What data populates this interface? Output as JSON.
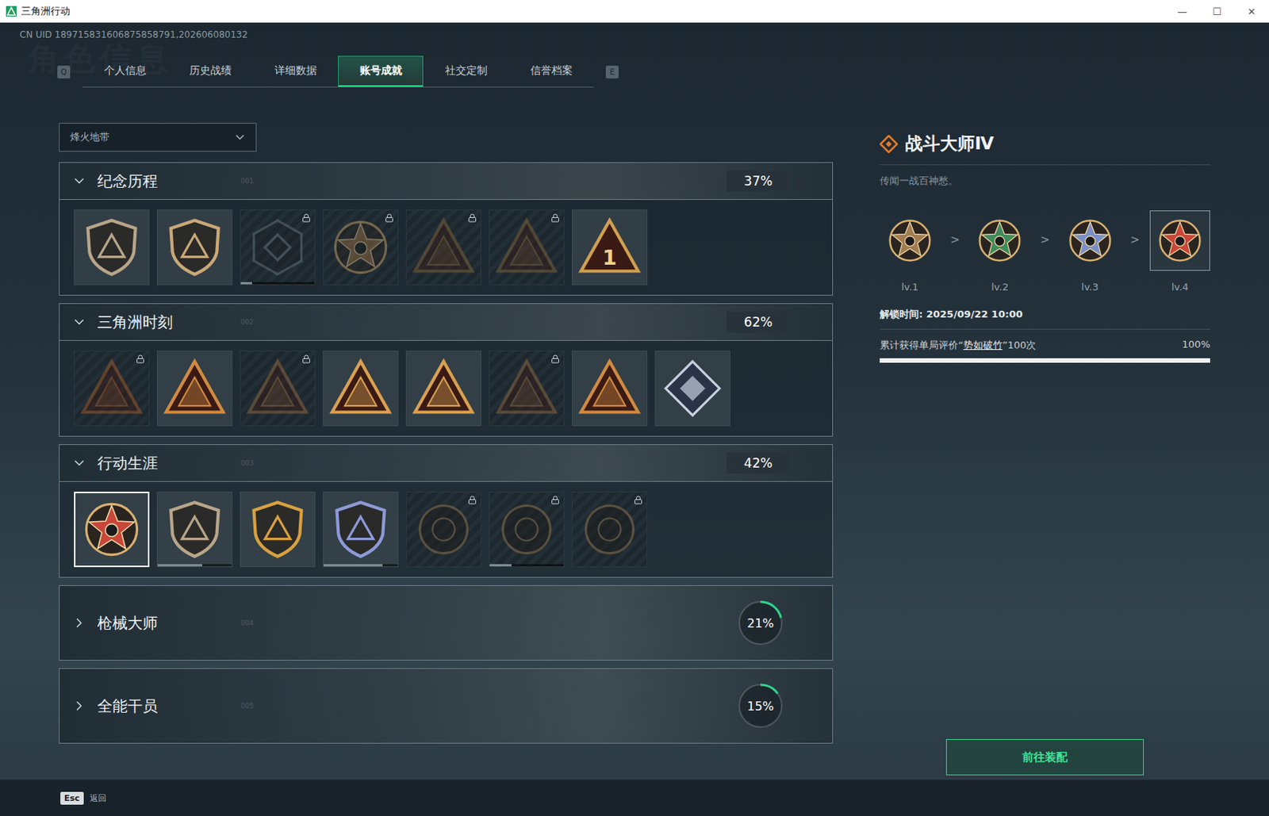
{
  "window": {
    "title": "三角洲行动",
    "controls": [
      "—",
      "☐",
      "✕"
    ]
  },
  "uid": "CN UID 189715831606875858791,202606080132",
  "watermark": "角色信息",
  "tabs": {
    "prev_key": "Q",
    "next_key": "E",
    "items": [
      {
        "label": "个人信息",
        "selected": false
      },
      {
        "label": "历史战绩",
        "selected": false
      },
      {
        "label": "详细数据",
        "selected": false
      },
      {
        "label": "账号成就",
        "selected": true
      },
      {
        "label": "社交定制",
        "selected": false
      },
      {
        "label": "信誉档案",
        "selected": false
      }
    ]
  },
  "mode_select": {
    "value": "烽火地带"
  },
  "sections": [
    {
      "title": "纪念历程",
      "code": "001",
      "percent": "37%",
      "expanded": true,
      "badges": [
        {
          "kind": "shield",
          "color": "#b8a58a",
          "locked": false,
          "selected": false
        },
        {
          "kind": "shield",
          "color": "#c9a878",
          "locked": false,
          "selected": false
        },
        {
          "kind": "hex",
          "color": "#6d7a86",
          "locked": true,
          "selected": false,
          "level": 0.15
        },
        {
          "kind": "crest",
          "color": "#a07040",
          "locked": true,
          "selected": false
        },
        {
          "kind": "triangle",
          "color": "#8a6a3a",
          "locked": true,
          "selected": false
        },
        {
          "kind": "triangle",
          "color": "#8a6a3a",
          "locked": true,
          "selected": false
        },
        {
          "kind": "triangle",
          "color": "#d0a050",
          "locked": false,
          "selected": false,
          "mark": "1"
        }
      ]
    },
    {
      "title": "三角洲时刻",
      "code": "002",
      "percent": "62%",
      "expanded": true,
      "badges": [
        {
          "kind": "triangle",
          "color": "#b0602a",
          "locked": true,
          "selected": false
        },
        {
          "kind": "triangle",
          "color": "#d08a40",
          "locked": false,
          "selected": false
        },
        {
          "kind": "triangle",
          "color": "#a07040",
          "locked": true,
          "selected": false
        },
        {
          "kind": "triangle",
          "color": "#d8a050",
          "locked": false,
          "selected": false
        },
        {
          "kind": "triangle",
          "color": "#d8a050",
          "locked": false,
          "selected": false
        },
        {
          "kind": "triangle",
          "color": "#9a7040",
          "locked": true,
          "selected": false
        },
        {
          "kind": "triangle",
          "color": "#d08a40",
          "locked": false,
          "selected": false
        },
        {
          "kind": "diamond",
          "color": "#c8d0e0",
          "locked": false,
          "selected": false
        }
      ]
    },
    {
      "title": "行动生涯",
      "code": "003",
      "percent": "42%",
      "expanded": true,
      "badges": [
        {
          "kind": "crest",
          "color": "#c8463a",
          "locked": false,
          "selected": true
        },
        {
          "kind": "shield",
          "color": "#b8a58a",
          "locked": false,
          "selected": false,
          "level": 0.6
        },
        {
          "kind": "shield",
          "color": "#d8a040",
          "locked": false,
          "selected": false
        },
        {
          "kind": "shield",
          "color": "#8c9ad8",
          "locked": false,
          "selected": false,
          "level": 0.8
        },
        {
          "kind": "round",
          "color": "#a08050",
          "locked": true,
          "selected": false
        },
        {
          "kind": "round",
          "color": "#a08050",
          "locked": true,
          "selected": false,
          "level": 0.3
        },
        {
          "kind": "round",
          "color": "#a08050",
          "locked": true,
          "selected": false
        }
      ]
    },
    {
      "title": "枪械大师",
      "code": "004",
      "percent": "21%",
      "expanded": false,
      "level": 0.21,
      "badges": []
    },
    {
      "title": "全能干员",
      "code": "005",
      "percent": "15%",
      "expanded": false,
      "level": 0.15,
      "badges": []
    }
  ],
  "detail": {
    "title": "战斗大师Ⅳ",
    "description": "传闻一战百神愁。",
    "separator": ">",
    "levels": [
      {
        "label": "lv.1",
        "color": "#a07c52",
        "selected": false
      },
      {
        "label": "lv.2",
        "color": "#3f8a5e",
        "selected": false
      },
      {
        "label": "lv.3",
        "color": "#7a8fc8",
        "selected": false
      },
      {
        "label": "lv.4",
        "color": "#c8463a",
        "selected": true
      }
    ],
    "unlock": "解锁时间: 2025/09/22 10:00",
    "requirement": {
      "prefix": "累计获得单局评价“",
      "highlight": "势如破竹",
      "suffix": "”100次",
      "percent": "100%",
      "level": 1
    },
    "button": "前往装配"
  },
  "footer": {
    "key": "Esc",
    "label": "返回"
  }
}
